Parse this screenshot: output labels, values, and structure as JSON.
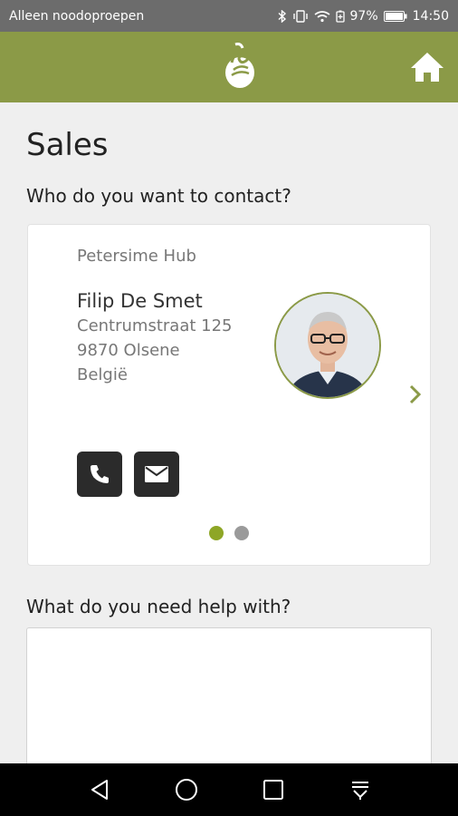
{
  "status_bar": {
    "carrier": "Alleen noodoproepen",
    "battery": "97%",
    "time": "14:50"
  },
  "colors": {
    "brand": "#8b9a47",
    "status_bar": "#6c6c6c",
    "dot_active": "#8ea626",
    "dot_inactive": "#9a9a9a",
    "action_button": "#2b2b2b"
  },
  "page": {
    "title": "Sales",
    "contact_question": "Who do you want to contact?",
    "help_question": "What do you need help with?"
  },
  "contact_card": {
    "hub": "Petersime Hub",
    "name": "Filip De Smet",
    "address_lines": [
      "Centrumstraat 125",
      "9870 Olsene",
      "België"
    ],
    "actions": [
      "phone-icon",
      "mail-icon"
    ],
    "pager": {
      "total": 2,
      "active": 1
    }
  },
  "help_input": {
    "value": ""
  },
  "icons": {
    "appbar": [
      "logo",
      "home-icon"
    ],
    "navbar": [
      "back-icon",
      "home-circle-icon",
      "recents-icon",
      "notifications-icon"
    ]
  }
}
